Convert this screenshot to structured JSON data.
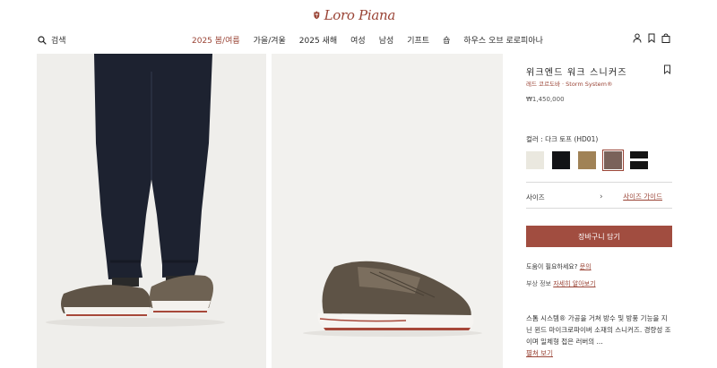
{
  "brand": {
    "logo_text": "Loro Piana",
    "color": "#9a4436"
  },
  "header": {
    "search_label": "검색",
    "nav": [
      {
        "label": "2025 봄/여름",
        "highlight": true
      },
      {
        "label": "가을/겨울",
        "highlight": false
      },
      {
        "label": "2025 새해",
        "highlight": false
      },
      {
        "label": "여성",
        "highlight": false
      },
      {
        "label": "남성",
        "highlight": false
      },
      {
        "label": "기프트",
        "highlight": false
      },
      {
        "label": "숍",
        "highlight": false
      },
      {
        "label": "하우스 오브 로로피아나",
        "highlight": false
      }
    ],
    "icons": [
      "account-icon",
      "bookmark-icon",
      "bag-icon"
    ]
  },
  "gallery": [
    {
      "name": "model-legs-image"
    },
    {
      "name": "sneaker-side-image"
    }
  ],
  "product": {
    "title": "위크엔드 워크 스니커즈",
    "material": "레드 코르도바 · Storm System®",
    "price": "₩1,450,000",
    "color_label": "컬러 : 다크 토프 (HD01)",
    "swatches": [
      {
        "color": "#eae8df",
        "selected": false
      },
      {
        "color": "#121316",
        "selected": false
      },
      {
        "color": "#a08256",
        "selected": false
      },
      {
        "color": "#7a625a",
        "selected": true
      },
      {
        "color": "#141414",
        "selected": false
      }
    ],
    "size_label": "사이즈",
    "size_chevron": "›",
    "size_guide": "사이즈 가이드",
    "add_to_cart": "장바구니 담기",
    "help_text": "도움이 필요하세요? ",
    "help_link": "문의",
    "info_text": "부상 정보 ",
    "info_link": "자세히 알아보기",
    "description": "스톰 시스템® 가공을 거쳐 방수 및 방풍 기능을 지닌 윈드 마이크로파이버 소재의 스니커즈. 경량성 조이며 일체형 접은 러버의 ...",
    "more": "펼쳐 보기"
  }
}
